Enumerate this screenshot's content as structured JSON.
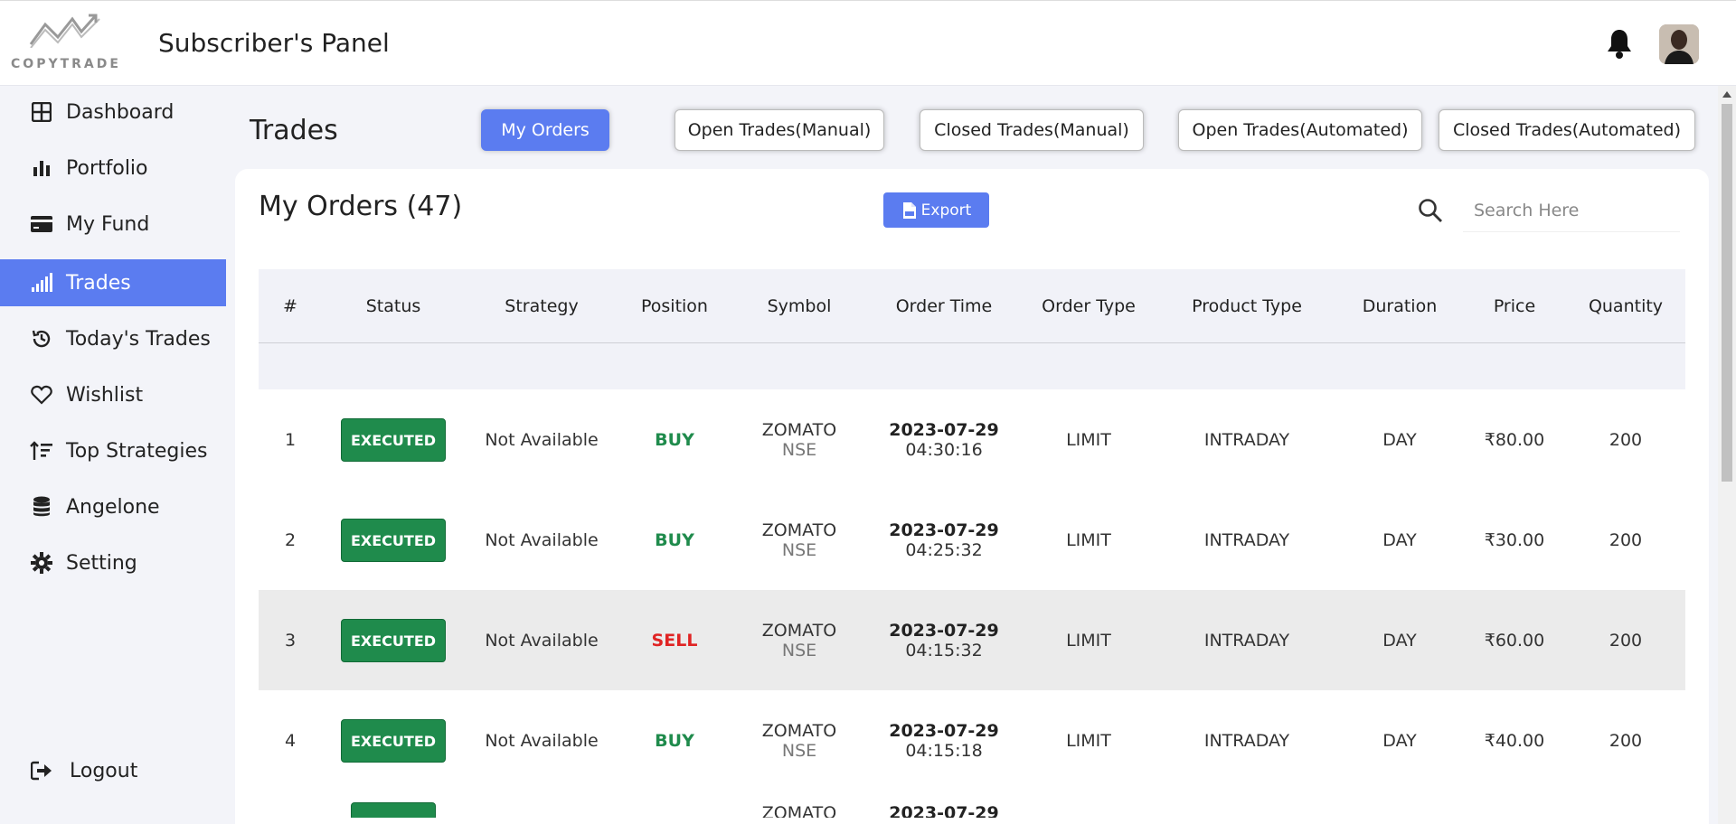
{
  "header": {
    "logo_text": "COPYTRADE",
    "panel_title": "Subscriber's Panel"
  },
  "sidebar": {
    "items": [
      {
        "label": "Dashboard",
        "icon": "grid-icon"
      },
      {
        "label": "Portfolio",
        "icon": "bar-chart-icon"
      },
      {
        "label": "My Fund",
        "icon": "credit-card-icon"
      },
      {
        "label": "Trades",
        "icon": "signal-icon",
        "active": true
      },
      {
        "label": "Today's Trades",
        "icon": "history-icon"
      },
      {
        "label": "Wishlist",
        "icon": "heart-icon"
      },
      {
        "label": "Top Strategies",
        "icon": "sort-amount-up-icon"
      },
      {
        "label": "Angelone",
        "icon": "database-icon"
      },
      {
        "label": "Setting",
        "icon": "gear-icon"
      }
    ],
    "logout_label": "Logout"
  },
  "main": {
    "title": "Trades",
    "tabs": [
      {
        "label": "My Orders",
        "active": true
      },
      {
        "label": "Open Trades(Manual)"
      },
      {
        "label": "Closed Trades(Manual)"
      },
      {
        "label": "Open Trades(Automated)"
      },
      {
        "label": "Closed Trades(Automated)"
      }
    ]
  },
  "card": {
    "title": "My Orders (47)",
    "export_label": "Export",
    "search_placeholder": "Search Here"
  },
  "table": {
    "columns": [
      "#",
      "Status",
      "Strategy",
      "Position",
      "Symbol",
      "Order Time",
      "Order Type",
      "Product Type",
      "Duration",
      "Price",
      "Quantity"
    ],
    "rows": [
      {
        "num": "1",
        "status": "EXECUTED",
        "strategy": "Not Available",
        "position": "BUY",
        "symbol": "ZOMATO",
        "exchange": "NSE",
        "date": "2023-07-29",
        "time": "04:30:16",
        "order_type": "LIMIT",
        "product_type": "INTRADAY",
        "duration": "DAY",
        "price": "₹80.00",
        "quantity": "200"
      },
      {
        "num": "2",
        "status": "EXECUTED",
        "strategy": "Not Available",
        "position": "BUY",
        "symbol": "ZOMATO",
        "exchange": "NSE",
        "date": "2023-07-29",
        "time": "04:25:32",
        "order_type": "LIMIT",
        "product_type": "INTRADAY",
        "duration": "DAY",
        "price": "₹30.00",
        "quantity": "200"
      },
      {
        "num": "3",
        "status": "EXECUTED",
        "strategy": "Not Available",
        "position": "SELL",
        "symbol": "ZOMATO",
        "exchange": "NSE",
        "date": "2023-07-29",
        "time": "04:15:32",
        "order_type": "LIMIT",
        "product_type": "INTRADAY",
        "duration": "DAY",
        "price": "₹60.00",
        "quantity": "200"
      },
      {
        "num": "4",
        "status": "EXECUTED",
        "strategy": "Not Available",
        "position": "BUY",
        "symbol": "ZOMATO",
        "exchange": "NSE",
        "date": "2023-07-29",
        "time": "04:15:18",
        "order_type": "LIMIT",
        "product_type": "INTRADAY",
        "duration": "DAY",
        "price": "₹40.00",
        "quantity": "200"
      }
    ],
    "partial_row": {
      "symbol": "ZOMATO",
      "date": "2023-07-29"
    }
  },
  "colors": {
    "accent": "#5b7cf0",
    "executed": "#1f8b4c",
    "buy": "#1f8b4c",
    "sell": "#e02424"
  }
}
